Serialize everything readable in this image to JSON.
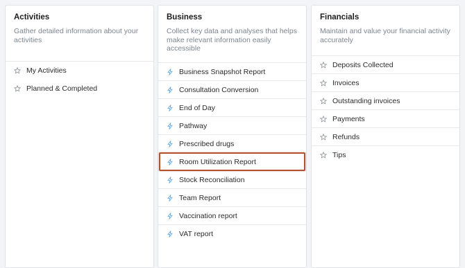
{
  "accent_color": "#b5502f",
  "columns": [
    {
      "title": "Activities",
      "description": "Gather detailed information about your activities",
      "icon": "star-icon",
      "items": [
        {
          "label": "My Activities"
        },
        {
          "label": "Planned & Completed"
        }
      ]
    },
    {
      "title": "Business",
      "description": "Collect key data and analyses that helps make relevant information easily accessible",
      "icon": "bolt-icon",
      "items": [
        {
          "label": "Business Snapshot Report"
        },
        {
          "label": "Consultation Conversion"
        },
        {
          "label": "End of Day"
        },
        {
          "label": "Pathway"
        },
        {
          "label": "Prescribed drugs"
        },
        {
          "label": "Room Utilization Report",
          "highlighted": true
        },
        {
          "label": "Stock Reconciliation"
        },
        {
          "label": "Team Report"
        },
        {
          "label": "Vaccination report"
        },
        {
          "label": "VAT report"
        }
      ]
    },
    {
      "title": "Financials",
      "description": "Maintain and value your financial activity accurately",
      "icon": "star-icon",
      "items": [
        {
          "label": "Deposits Collected"
        },
        {
          "label": "Invoices"
        },
        {
          "label": "Outstanding invoices"
        },
        {
          "label": "Payments"
        },
        {
          "label": "Refunds"
        },
        {
          "label": "Tips"
        }
      ]
    }
  ]
}
